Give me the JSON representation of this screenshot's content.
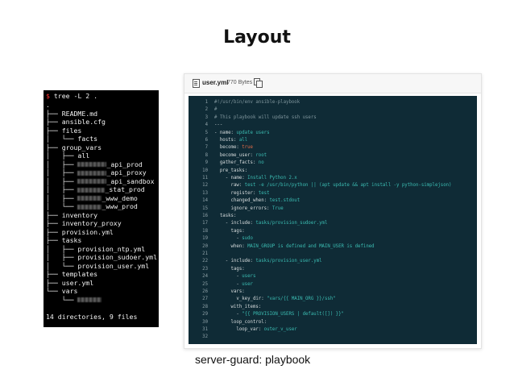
{
  "title": "Layout",
  "caption": "server-guard: playbook",
  "terminal": {
    "prompt": "$",
    "command": " tree -L 2 .",
    "lines": [
      {
        "text": "."
      },
      {
        "text": "├── README.md"
      },
      {
        "text": "├── ansible.cfg"
      },
      {
        "text": "├── files"
      },
      {
        "text": "│   └── facts"
      },
      {
        "text": "├── group_vars"
      },
      {
        "text": "│   ├── all"
      },
      {
        "text": "│   ├── ",
        "blur": 36,
        "after": "_api_prod"
      },
      {
        "text": "│   ├── ",
        "blur": 36,
        "after": "_api_proxy"
      },
      {
        "text": "│   ├── ",
        "blur": 36,
        "after": "_api_sandbox"
      },
      {
        "text": "│   ├── ",
        "blur": 34,
        "after": "_stat_prod"
      },
      {
        "text": "│   ├── ",
        "blur": 30,
        "after": "_www_demo"
      },
      {
        "text": "│   └── ",
        "blur": 30,
        "after": "_www_prod"
      },
      {
        "text": "├── inventory"
      },
      {
        "text": "├── inventory_proxy"
      },
      {
        "text": "├── provision.yml"
      },
      {
        "text": "├── tasks"
      },
      {
        "text": "│   ├── provision_ntp.yml"
      },
      {
        "text": "│   ├── provision_sudoer.yml"
      },
      {
        "text": "│   └── provision_user.yml"
      },
      {
        "text": "├── templates"
      },
      {
        "text": "├── user.yml"
      },
      {
        "text": "└── vars"
      },
      {
        "text": "    └── ",
        "blur": 30,
        "after": ""
      },
      {
        "text": ""
      },
      {
        "text": "14 directories, 9 files"
      }
    ]
  },
  "file": {
    "name": "user.yml",
    "size": "770 Bytes"
  },
  "code_lines": [
    [
      {
        "c": "t-c",
        "t": "#!/usr/bin/env ansible-playbook"
      }
    ],
    [
      {
        "c": "t-c",
        "t": "#"
      }
    ],
    [
      {
        "c": "t-c",
        "t": "# This playbook will update ssh users"
      }
    ],
    [
      {
        "c": "t-p",
        "t": "---"
      }
    ],
    [
      {
        "c": "t-k",
        "t": "- name: "
      },
      {
        "c": "t-s",
        "t": "update users"
      }
    ],
    [
      {
        "c": "t-k",
        "t": "  hosts: "
      },
      {
        "c": "t-s",
        "t": "all"
      }
    ],
    [
      {
        "c": "t-k",
        "t": "  become: "
      },
      {
        "c": "t-r",
        "t": "true"
      }
    ],
    [
      {
        "c": "t-k",
        "t": "  become_user: "
      },
      {
        "c": "t-s",
        "t": "root"
      }
    ],
    [
      {
        "c": "t-k",
        "t": "  gather_facts: "
      },
      {
        "c": "t-s",
        "t": "no"
      }
    ],
    [
      {
        "c": "t-k",
        "t": "  pre_tasks:"
      }
    ],
    [
      {
        "c": "t-k",
        "t": "    - name: "
      },
      {
        "c": "t-s",
        "t": "Install Python 2.x"
      }
    ],
    [
      {
        "c": "t-k",
        "t": "      raw: "
      },
      {
        "c": "t-s",
        "t": "test -e /usr/bin/python || (apt update && apt install -y python-simplejson)"
      }
    ],
    [
      {
        "c": "t-k",
        "t": "      register: "
      },
      {
        "c": "t-s",
        "t": "test"
      }
    ],
    [
      {
        "c": "t-k",
        "t": "      changed_when: "
      },
      {
        "c": "t-s",
        "t": "test.stdout"
      }
    ],
    [
      {
        "c": "t-k",
        "t": "      ignore_errors: "
      },
      {
        "c": "t-s",
        "t": "True"
      }
    ],
    [
      {
        "c": "t-k",
        "t": "  tasks:"
      }
    ],
    [
      {
        "c": "t-k",
        "t": "    - include: "
      },
      {
        "c": "t-s",
        "t": "tasks/provision_sudoer.yml"
      }
    ],
    [
      {
        "c": "t-k",
        "t": "      tags:"
      }
    ],
    [
      {
        "c": "t-k",
        "t": "        - "
      },
      {
        "c": "t-s",
        "t": "sudo"
      }
    ],
    [
      {
        "c": "t-k",
        "t": "      when: "
      },
      {
        "c": "t-s",
        "t": "MAIN_GROUP is defined and MAIN_USER is defined"
      }
    ],
    [
      {
        "c": "t-k",
        "t": ""
      }
    ],
    [
      {
        "c": "t-k",
        "t": "    - include: "
      },
      {
        "c": "t-s",
        "t": "tasks/provision_user.yml"
      }
    ],
    [
      {
        "c": "t-k",
        "t": "      tags:"
      }
    ],
    [
      {
        "c": "t-k",
        "t": "        - "
      },
      {
        "c": "t-s",
        "t": "users"
      }
    ],
    [
      {
        "c": "t-k",
        "t": "        - "
      },
      {
        "c": "t-s",
        "t": "user"
      }
    ],
    [
      {
        "c": "t-k",
        "t": "      vars:"
      }
    ],
    [
      {
        "c": "t-k",
        "t": "        v_key_dir: "
      },
      {
        "c": "t-s",
        "t": "\"vars/{{ MAIN_ORG }}/ssh\""
      }
    ],
    [
      {
        "c": "t-k",
        "t": "      with_items:"
      }
    ],
    [
      {
        "c": "t-k",
        "t": "        - "
      },
      {
        "c": "t-s",
        "t": "\"{{ PROVISION_USERS | default([]) }}\""
      }
    ],
    [
      {
        "c": "t-k",
        "t": "      loop_control:"
      }
    ],
    [
      {
        "c": "t-k",
        "t": "        loop_var: "
      },
      {
        "c": "t-s",
        "t": "outer_v_user"
      }
    ],
    [
      {
        "c": "t-k",
        "t": ""
      }
    ]
  ],
  "icons": {
    "file": "file-icon",
    "copy": "copy-icon"
  }
}
